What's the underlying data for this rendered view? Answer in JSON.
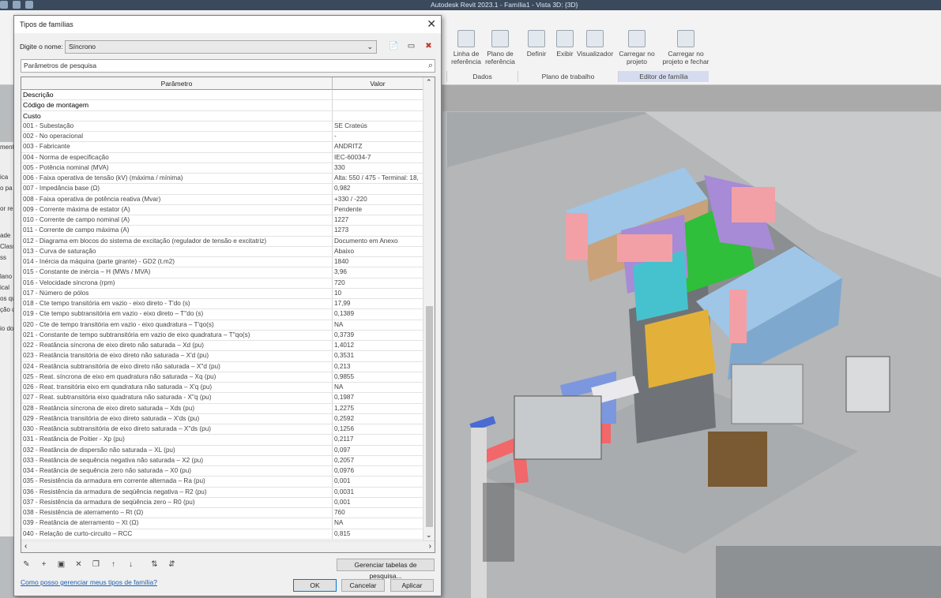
{
  "app": {
    "window_title": "Autodesk Revit 2023.1 - Família1 - Vista 3D: {3D}"
  },
  "ribbon": {
    "buttons": [
      {
        "label": "Linha de referência",
        "icon": "reference-line-icon"
      },
      {
        "label": "Plano de referência",
        "icon": "reference-plane-icon"
      },
      {
        "label": "Definir",
        "icon": "set-workplane-icon"
      },
      {
        "label": "Exibir",
        "icon": "show-workplane-icon"
      },
      {
        "label": "Visualizador",
        "icon": "viewer-icon"
      },
      {
        "label": "Carregar no projeto",
        "icon": "load-into-project-icon"
      },
      {
        "label": "Carregar no projeto e fechar",
        "icon": "load-and-close-icon"
      }
    ],
    "panels": [
      "Dados",
      "Plano de trabalho",
      "Editor de família"
    ]
  },
  "left_props": [
    "mento",
    "ica",
    "o pa",
    "or re",
    "ade",
    "Class",
    "ss",
    "lano",
    "ical",
    "os qu",
    "ção d",
    "io do"
  ],
  "dialog": {
    "title": "Tipos de famílias",
    "name_label": "Digite o nome:",
    "name_value": "Síncrono",
    "search_placeholder": "Parâmetros de pesquisa",
    "columns": [
      "Parâmetro",
      "Valor"
    ],
    "rows": [
      {
        "param": "Descrição",
        "value": "",
        "group": true
      },
      {
        "param": "Código de montagem",
        "value": "",
        "group": true
      },
      {
        "param": "Custo",
        "value": "",
        "group": true
      },
      {
        "param": "001 - Subestação",
        "value": "SE Crateús"
      },
      {
        "param": "002 - No operacional",
        "value": "-"
      },
      {
        "param": "003 - Fabricante",
        "value": "ANDRITZ"
      },
      {
        "param": "004 - Norma de especificação",
        "value": "IEC-60034-7"
      },
      {
        "param": "005 - Potência nominal (MVA)",
        "value": "330"
      },
      {
        "param": "006 - Faixa operativa de tensão (kV) (máxima / mínima)",
        "value": "Alta: 550 / 475 - Terminal: 18,"
      },
      {
        "param": "007 - Impedância base (Ω)",
        "value": "0,982"
      },
      {
        "param": "008 - Faixa operativa de potência reativa (Mvar)",
        "value": "+330 / -220"
      },
      {
        "param": "009 - Corrente máxima de estator (A)",
        "value": "Pendente"
      },
      {
        "param": "010 - Corrente de campo nominal (A)",
        "value": "1227"
      },
      {
        "param": "011 - Corrente de campo máxima (A)",
        "value": "1273"
      },
      {
        "param": "012 - Diagrama em blocos do sistema de excitação (regulador de tensão e excitatriz)",
        "value": "Documento em Anexo"
      },
      {
        "param": "013 - Curva de saturação",
        "value": "Abaixo"
      },
      {
        "param": "014 - Inércia da máquina (parte girante) - GD2  (t.m2)",
        "value": "1840"
      },
      {
        "param": "015 - Constante de inércia – H (MWs / MVA)",
        "value": "3,96"
      },
      {
        "param": "016 - Velocidade síncrona (rpm)",
        "value": "720"
      },
      {
        "param": "017 - Número de pólos",
        "value": "10"
      },
      {
        "param": "018 - Cte tempo transitória em vazio - eixo direto - T'do (s)",
        "value": "17,99"
      },
      {
        "param": "019 - Cte tempo subtransitória em vazio - eixo direto – T''do (s)",
        "value": "0,1389"
      },
      {
        "param": "020 - Cte de tempo transitória em vazio - eixo quadratura – T'qo(s)",
        "value": "NA"
      },
      {
        "param": "021 - Constante de tempo subtransitória em vazio de eixo quadratura – T''qo(s)",
        "value": "0,3739"
      },
      {
        "param": "022 - Reatância síncrona de eixo direto não saturada – Xd (pu)",
        "value": "1,4012"
      },
      {
        "param": "023 - Reatância transitória de eixo direto não saturada – X'd (pu)",
        "value": "0,3531"
      },
      {
        "param": "024 - Reatância subtransitória de eixo direto não saturada – X''d (pu)",
        "value": "0,213"
      },
      {
        "param": "025 - Reat. síncrona de eixo em quadratura não saturada – Xq (pu)",
        "value": "0,9855"
      },
      {
        "param": "026 - Reat. transitória eixo em quadratura não saturada – X'q (pu)",
        "value": "NA"
      },
      {
        "param": "027 - Reat. subtransitória eixo quadratura não saturada - X''q (pu)",
        "value": "0,1987"
      },
      {
        "param": "028 - Reatância síncrona de eixo direto saturada – Xds (pu)",
        "value": "1,2275"
      },
      {
        "param": "029 - Reatância transitória de eixo direto saturada – X'ds (pu)",
        "value": "0,2592"
      },
      {
        "param": "030 - Reatância subtransitória de eixo direto saturada – X''ds (pu)",
        "value": "0,1256"
      },
      {
        "param": "031 - Reatância de Poitier - Xp (pu)",
        "value": "0,2117"
      },
      {
        "param": "032 - Reatância de dispersão não saturada – XL (pu)",
        "value": "0,097"
      },
      {
        "param": "033 - Reatância de sequência negativa não saturada – X2 (pu)",
        "value": "0,2057"
      },
      {
        "param": "034 - Reatância de sequência zero não saturada – X0 (pu)",
        "value": "0,0976"
      },
      {
        "param": "035 - Resistência da armadura em corrente alternada – Ra (pu)",
        "value": "0,001"
      },
      {
        "param": "036 - Resistência da armadura de seqüência negativa – R2 (pu)",
        "value": "0,0031"
      },
      {
        "param": "037 - Resistência da armadura de seqüência zero – R0 (pu)",
        "value": "0,001"
      },
      {
        "param": "038 - Resistência de aterramento – Rt (Ω)",
        "value": "760"
      },
      {
        "param": "039 - Reatância de aterramento – Xt (Ω)",
        "value": "NA"
      },
      {
        "param": "040 - Relação de curto-circuito – RCC",
        "value": "0,815"
      }
    ],
    "manage_button": "Gerenciar tabelas de pesquisa...",
    "help_link": "Como posso gerenciar meus tipos de família?",
    "ok": "OK",
    "cancel": "Cancelar",
    "apply": "Aplicar"
  }
}
